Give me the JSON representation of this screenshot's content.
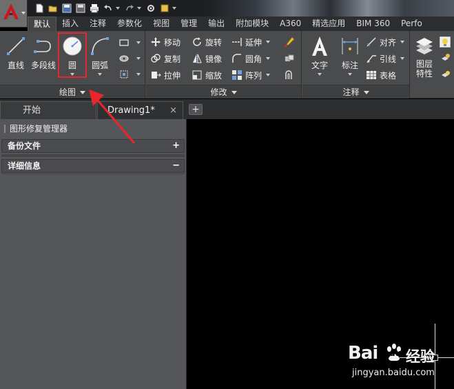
{
  "titlebar": {
    "qat_icons": [
      "new-icon",
      "open-icon",
      "save-icon",
      "save-as-icon",
      "print-icon",
      "undo-icon",
      "redo-icon",
      "workspace-icon",
      "workspace-more-icon"
    ]
  },
  "tabs": [
    {
      "label": "默认",
      "active": true
    },
    {
      "label": "插入"
    },
    {
      "label": "注释"
    },
    {
      "label": "参数化"
    },
    {
      "label": "视图"
    },
    {
      "label": "管理"
    },
    {
      "label": "输出"
    },
    {
      "label": "附加模块"
    },
    {
      "label": "A360"
    },
    {
      "label": "精选应用"
    },
    {
      "label": "BIM 360"
    },
    {
      "label": "Perfo"
    }
  ],
  "ribbon": {
    "draw": {
      "title": "绘图",
      "line": "直线",
      "polyline": "多段线",
      "circle": "圆",
      "arc": "圆弧"
    },
    "modify": {
      "title": "修改",
      "move": "移动",
      "rotate": "旋转",
      "extend": "延伸",
      "copy": "复制",
      "mirror": "镜像",
      "fillet": "圆角",
      "stretch": "拉伸",
      "scale": "缩放",
      "array": "阵列"
    },
    "annotation": {
      "title": "注释",
      "text": "文字",
      "dimension": "标注",
      "align": "对齐",
      "leader": "引线",
      "table": "表格"
    },
    "layers": {
      "properties": "图层\n特性"
    }
  },
  "filetabs": {
    "start": "开始",
    "drawing": "Drawing1*",
    "close": "×",
    "new": "+"
  },
  "palette": {
    "title": "图形修复管理器",
    "backup": "备份文件",
    "backup_sign": "+",
    "details": "详细信息",
    "details_sign": "−"
  },
  "watermark": {
    "brand": "Bai",
    "brand2": "du",
    "suffix": "经验",
    "url": "jingyan.baidu.com"
  },
  "colors": {
    "highlight": "#e8262d",
    "app_red": "#c8171e"
  }
}
